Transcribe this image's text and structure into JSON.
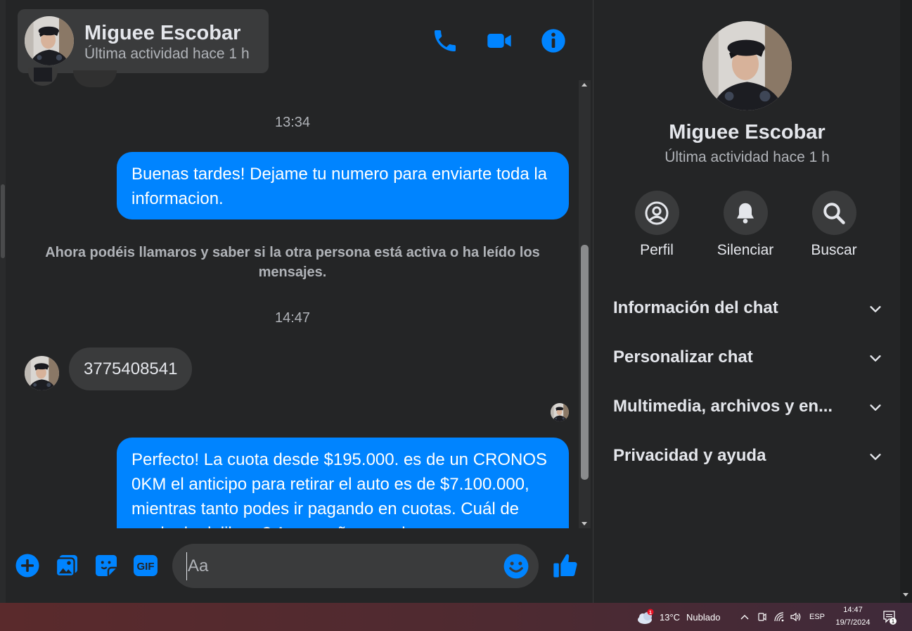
{
  "contact": {
    "name": "Miguee Escobar",
    "status": "Última actividad hace 1 h"
  },
  "header_actions": [
    {
      "name": "phone-call-icon"
    },
    {
      "name": "video-call-icon"
    },
    {
      "name": "info-icon"
    }
  ],
  "conversation": {
    "timestamp_1": "13:34",
    "outgoing_1": "Buenas tardes! Dejame tu numero para enviarte toda la informacion.",
    "system_notice": "Ahora podéis llamaros y saber si la otra persona está activa o ha leído los mensajes.",
    "timestamp_2": "14:47",
    "incoming_1": "3775408541",
    "outgoing_2": "Perfecto! La cuota desde $195.000. es de un CRONOS 0KM el anticipo para retirar el auto es de $7.100.000, mientras tanto podes ir pagando en cuotas. Cuál de modo de deliberg? Acompañamos el"
  },
  "composer": {
    "placeholder": "Aa",
    "buttons": [
      "plus-icon",
      "photo-icon",
      "sticker-icon",
      "gif-icon"
    ],
    "gif_label": "GIF"
  },
  "info_panel": {
    "actions": [
      {
        "label": "Perfil",
        "icon": "profile-icon"
      },
      {
        "label": "Silenciar",
        "icon": "bell-icon"
      },
      {
        "label": "Buscar",
        "icon": "search-icon"
      }
    ],
    "sections": [
      {
        "title": "Información del chat"
      },
      {
        "title": "Personalizar chat"
      },
      {
        "title": "Multimedia, archivos y en..."
      },
      {
        "title": "Privacidad y ayuda"
      }
    ]
  },
  "taskbar": {
    "weather_temp": "13°C",
    "weather_desc": "Nublado",
    "weather_badge": "1",
    "language": "ESP",
    "time": "14:47",
    "date": "19/7/2024",
    "notification_count": "1"
  },
  "colors": {
    "accent": "#0084ff",
    "background": "#242526",
    "bubble_incoming": "#3a3b3c",
    "text_primary": "#e4e6eb",
    "text_secondary": "#b0b3b8"
  }
}
